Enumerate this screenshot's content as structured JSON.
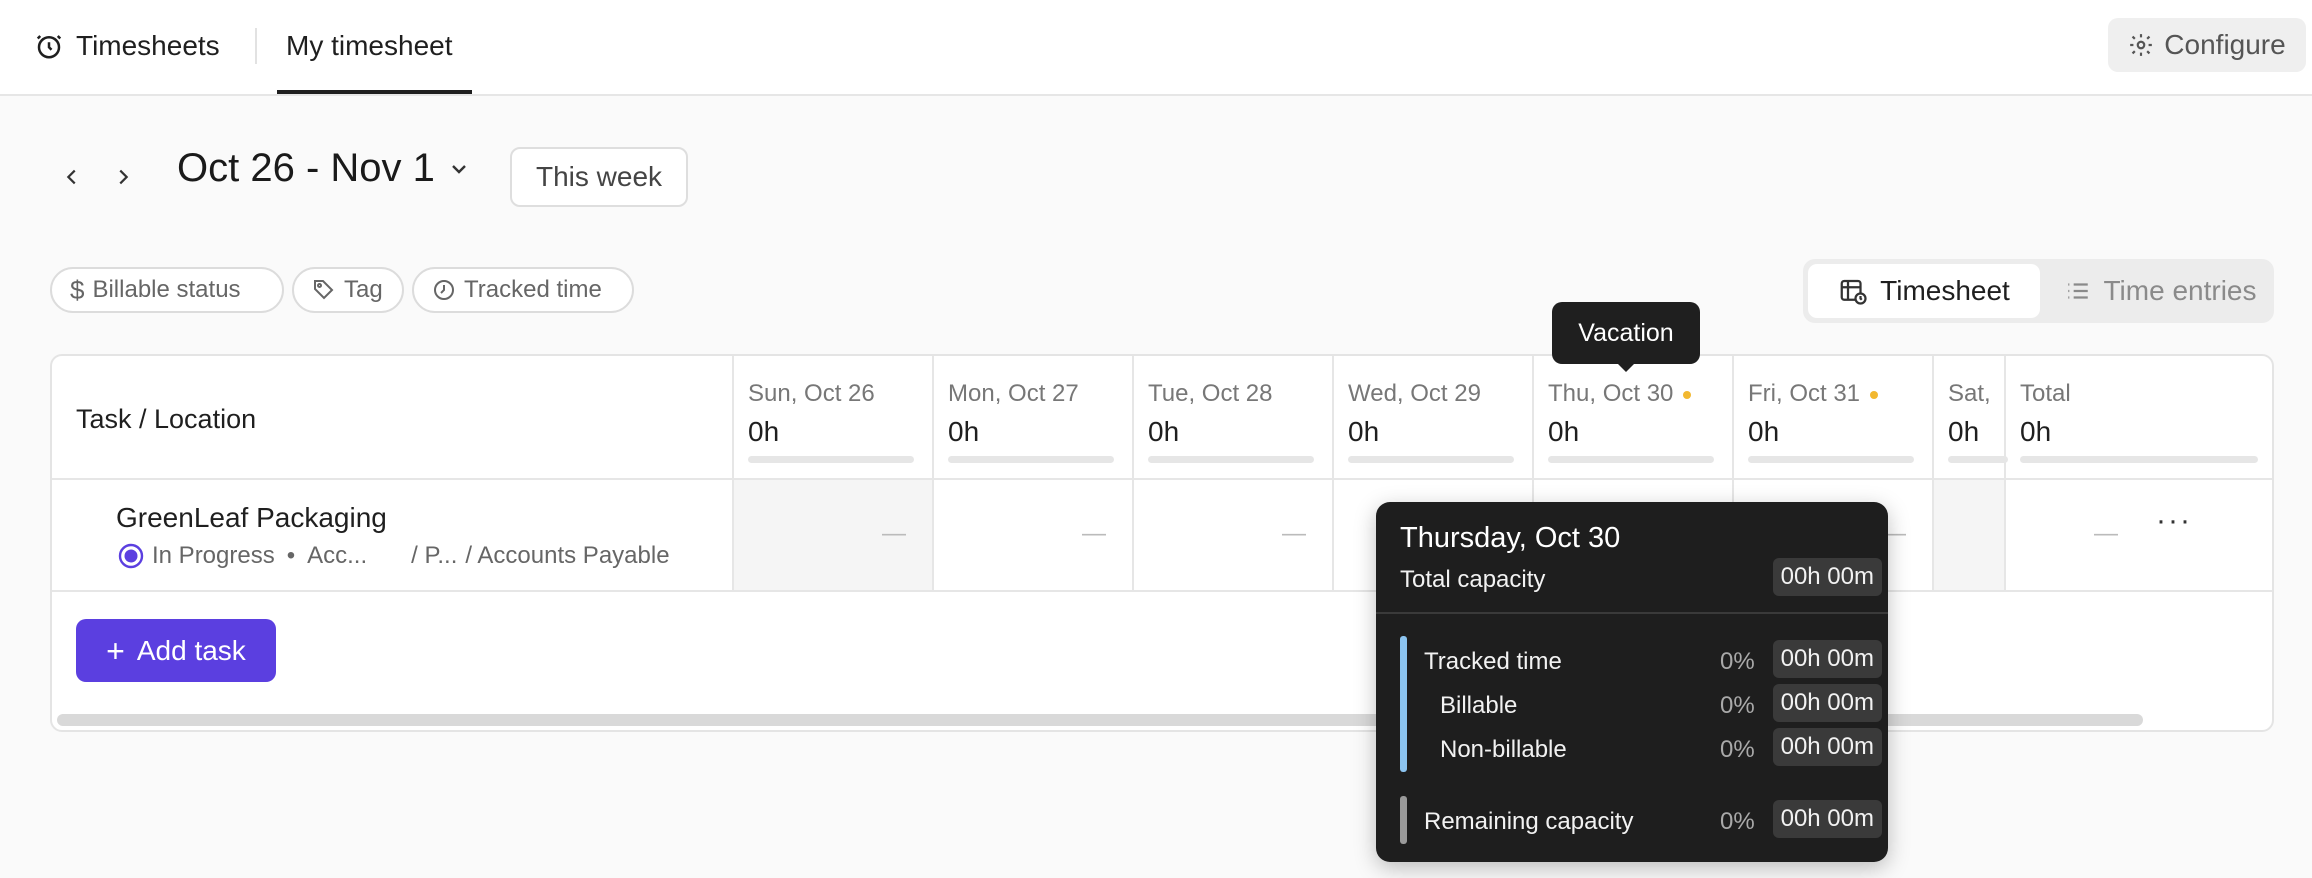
{
  "topbar": {
    "app_tab": "Timesheets",
    "active_tab": "My timesheet",
    "configure_label": "Configure"
  },
  "date_nav": {
    "range": "Oct 26 - Nov 1",
    "this_week_label": "This week"
  },
  "filters": [
    {
      "label": "Billable status",
      "icon": "dollar-icon"
    },
    {
      "label": "Tag",
      "icon": "tag-icon"
    },
    {
      "label": "Tracked time",
      "icon": "clock-icon"
    }
  ],
  "view_toggle": {
    "timesheet_label": "Timesheet",
    "time_entries_label": "Time entries",
    "active": "Timesheet"
  },
  "table": {
    "first_col_header": "Task / Location",
    "columns": [
      {
        "day": "Sun, Oct 26",
        "hours": "0h"
      },
      {
        "day": "Mon, Oct 27",
        "hours": "0h"
      },
      {
        "day": "Tue, Oct 28",
        "hours": "0h"
      },
      {
        "day": "Wed, Oct 29",
        "hours": "0h"
      },
      {
        "day": "Thu, Oct 30",
        "hours": "0h"
      },
      {
        "day": "Fri, Oct 31",
        "hours": "0h"
      },
      {
        "day": "Sat,",
        "hours": "0h"
      },
      {
        "day": "Total",
        "hours": "0h"
      }
    ],
    "rows": [
      {
        "task": "GreenLeaf Packaging",
        "status": "In Progress",
        "bullet": "•",
        "location_1": "Acc...",
        "location_2": "/ P...",
        "location_3": "/ Accounts Payable",
        "cell": "—"
      }
    ],
    "add_task_label": "Add task"
  },
  "vacation_tooltip": {
    "label": "Vacation"
  },
  "capacity_popover": {
    "title": "Thursday, Oct 30",
    "total_capacity_label": "Total capacity",
    "total_capacity_value": "00h 00m",
    "tracked_label": "Tracked time",
    "tracked_pct": "0%",
    "tracked_value": "00h 00m",
    "billable_label": "Billable",
    "billable_pct": "0%",
    "billable_value": "00h 00m",
    "nonbillable_label": "Non-billable",
    "nonbillable_pct": "0%",
    "nonbillable_value": "00h 00m",
    "remaining_label": "Remaining capacity",
    "remaining_pct": "0%",
    "remaining_value": "00h 00m"
  },
  "colors": {
    "accent": "#5b3fe0",
    "vacation_dot": "#f2b830",
    "tracked_bar": "#8cc4f0",
    "remaining_bar": "#9a9a9a"
  }
}
